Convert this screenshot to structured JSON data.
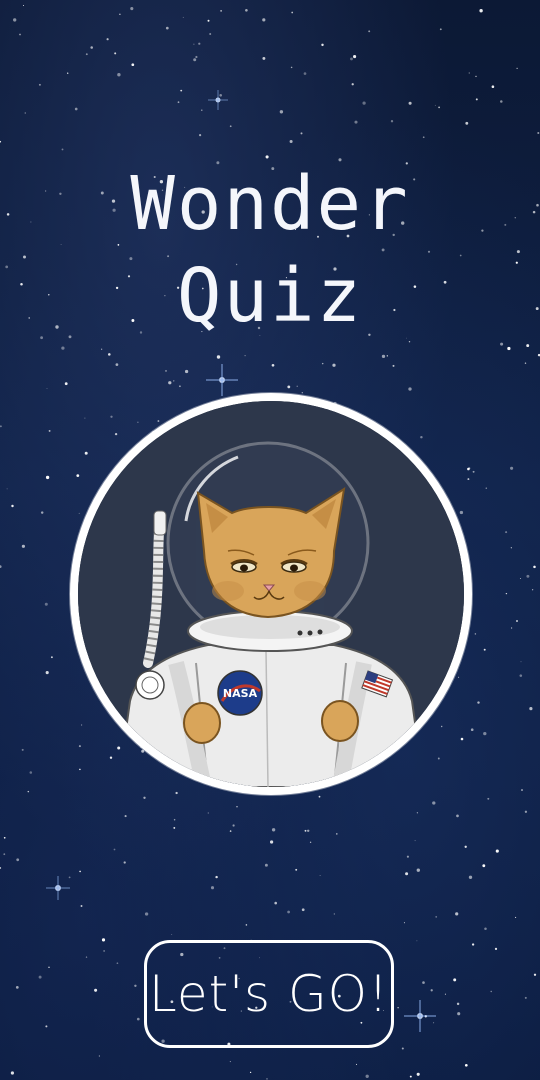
{
  "app": {
    "title_line1": "Wonder",
    "title_line2": "Quiz"
  },
  "avatar": {
    "icon": "astronaut-cat",
    "patch_text": "NASA"
  },
  "actions": {
    "start_label": "Let's GO!"
  },
  "colors": {
    "background": "#0c1935",
    "text": "#f4f6fb",
    "avatar_bg": "#2b3546",
    "cat_fur": "#d9a55a",
    "suit": "#eeeeee"
  }
}
